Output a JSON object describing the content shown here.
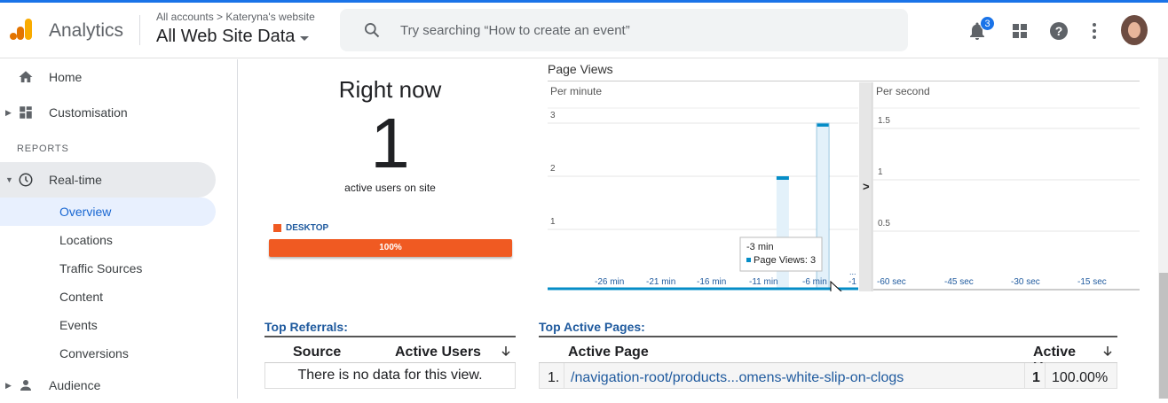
{
  "header": {
    "app_name": "Analytics",
    "breadcrumb_accounts": "All accounts",
    "breadcrumb_site": "Kateryna's website",
    "breadcrumb_sep": ">",
    "view_name": "All Web Site Data",
    "search_placeholder": "Try searching “How to create an event”",
    "notification_count": "3"
  },
  "sidebar": {
    "home": "Home",
    "customisation": "Customisation",
    "section_reports": "REPORTS",
    "realtime": "Real-time",
    "sub_items": [
      "Overview",
      "Locations",
      "Traffic Sources",
      "Content",
      "Events",
      "Conversions"
    ],
    "audience": "Audience"
  },
  "right_now": {
    "title": "Right now",
    "active_users": "1",
    "subtitle": "active users on site",
    "device_label": "DESKTOP",
    "device_percent": "100%",
    "device_fraction": 1.0
  },
  "page_views": {
    "title": "Page Views",
    "per_minute_label": "Per minute",
    "per_second_label": "Per second",
    "tooltip_time": "-3 min",
    "tooltip_text": "Page Views: 3",
    "expand_arrow": ">",
    "minute_ellipsis": "..."
  },
  "chart_data": [
    {
      "type": "bar",
      "title": "Per minute",
      "x_tick_labels": [
        "-26 min",
        "-21 min",
        "-16 min",
        "-11 min",
        "-6 min",
        "-1"
      ],
      "y_tick_labels": [
        "1",
        "2",
        "3"
      ],
      "bars": [
        {
          "x": -7,
          "value": 2
        },
        {
          "x": -3,
          "value": 3
        }
      ],
      "ylim": [
        0,
        4
      ],
      "grid": true
    },
    {
      "type": "bar",
      "title": "Per second",
      "x_tick_labels": [
        "-60 sec",
        "-45 sec",
        "-30 sec",
        "-15 sec"
      ],
      "y_tick_labels": [
        "0.5",
        "1",
        "1.5"
      ],
      "bars": [],
      "ylim": [
        0,
        2
      ],
      "grid": true
    }
  ],
  "top_referrals": {
    "title": "Top Referrals:",
    "col_source": "Source",
    "col_active_users": "Active Users",
    "empty_message": "There is no data for this view."
  },
  "top_active_pages": {
    "title": "Top Active Pages:",
    "col_active_page": "Active Page",
    "col_active_users": "Active Users",
    "rows": [
      {
        "index": "1.",
        "page": "/navigation-root/products...omens-white-slip-on-clogs",
        "users": "1",
        "percent": "100.00%"
      }
    ]
  },
  "colors": {
    "accent": "#1a73e8",
    "desktop": "#f05a22",
    "link": "#1f5a9e",
    "chart_bar": "#058dc7"
  }
}
